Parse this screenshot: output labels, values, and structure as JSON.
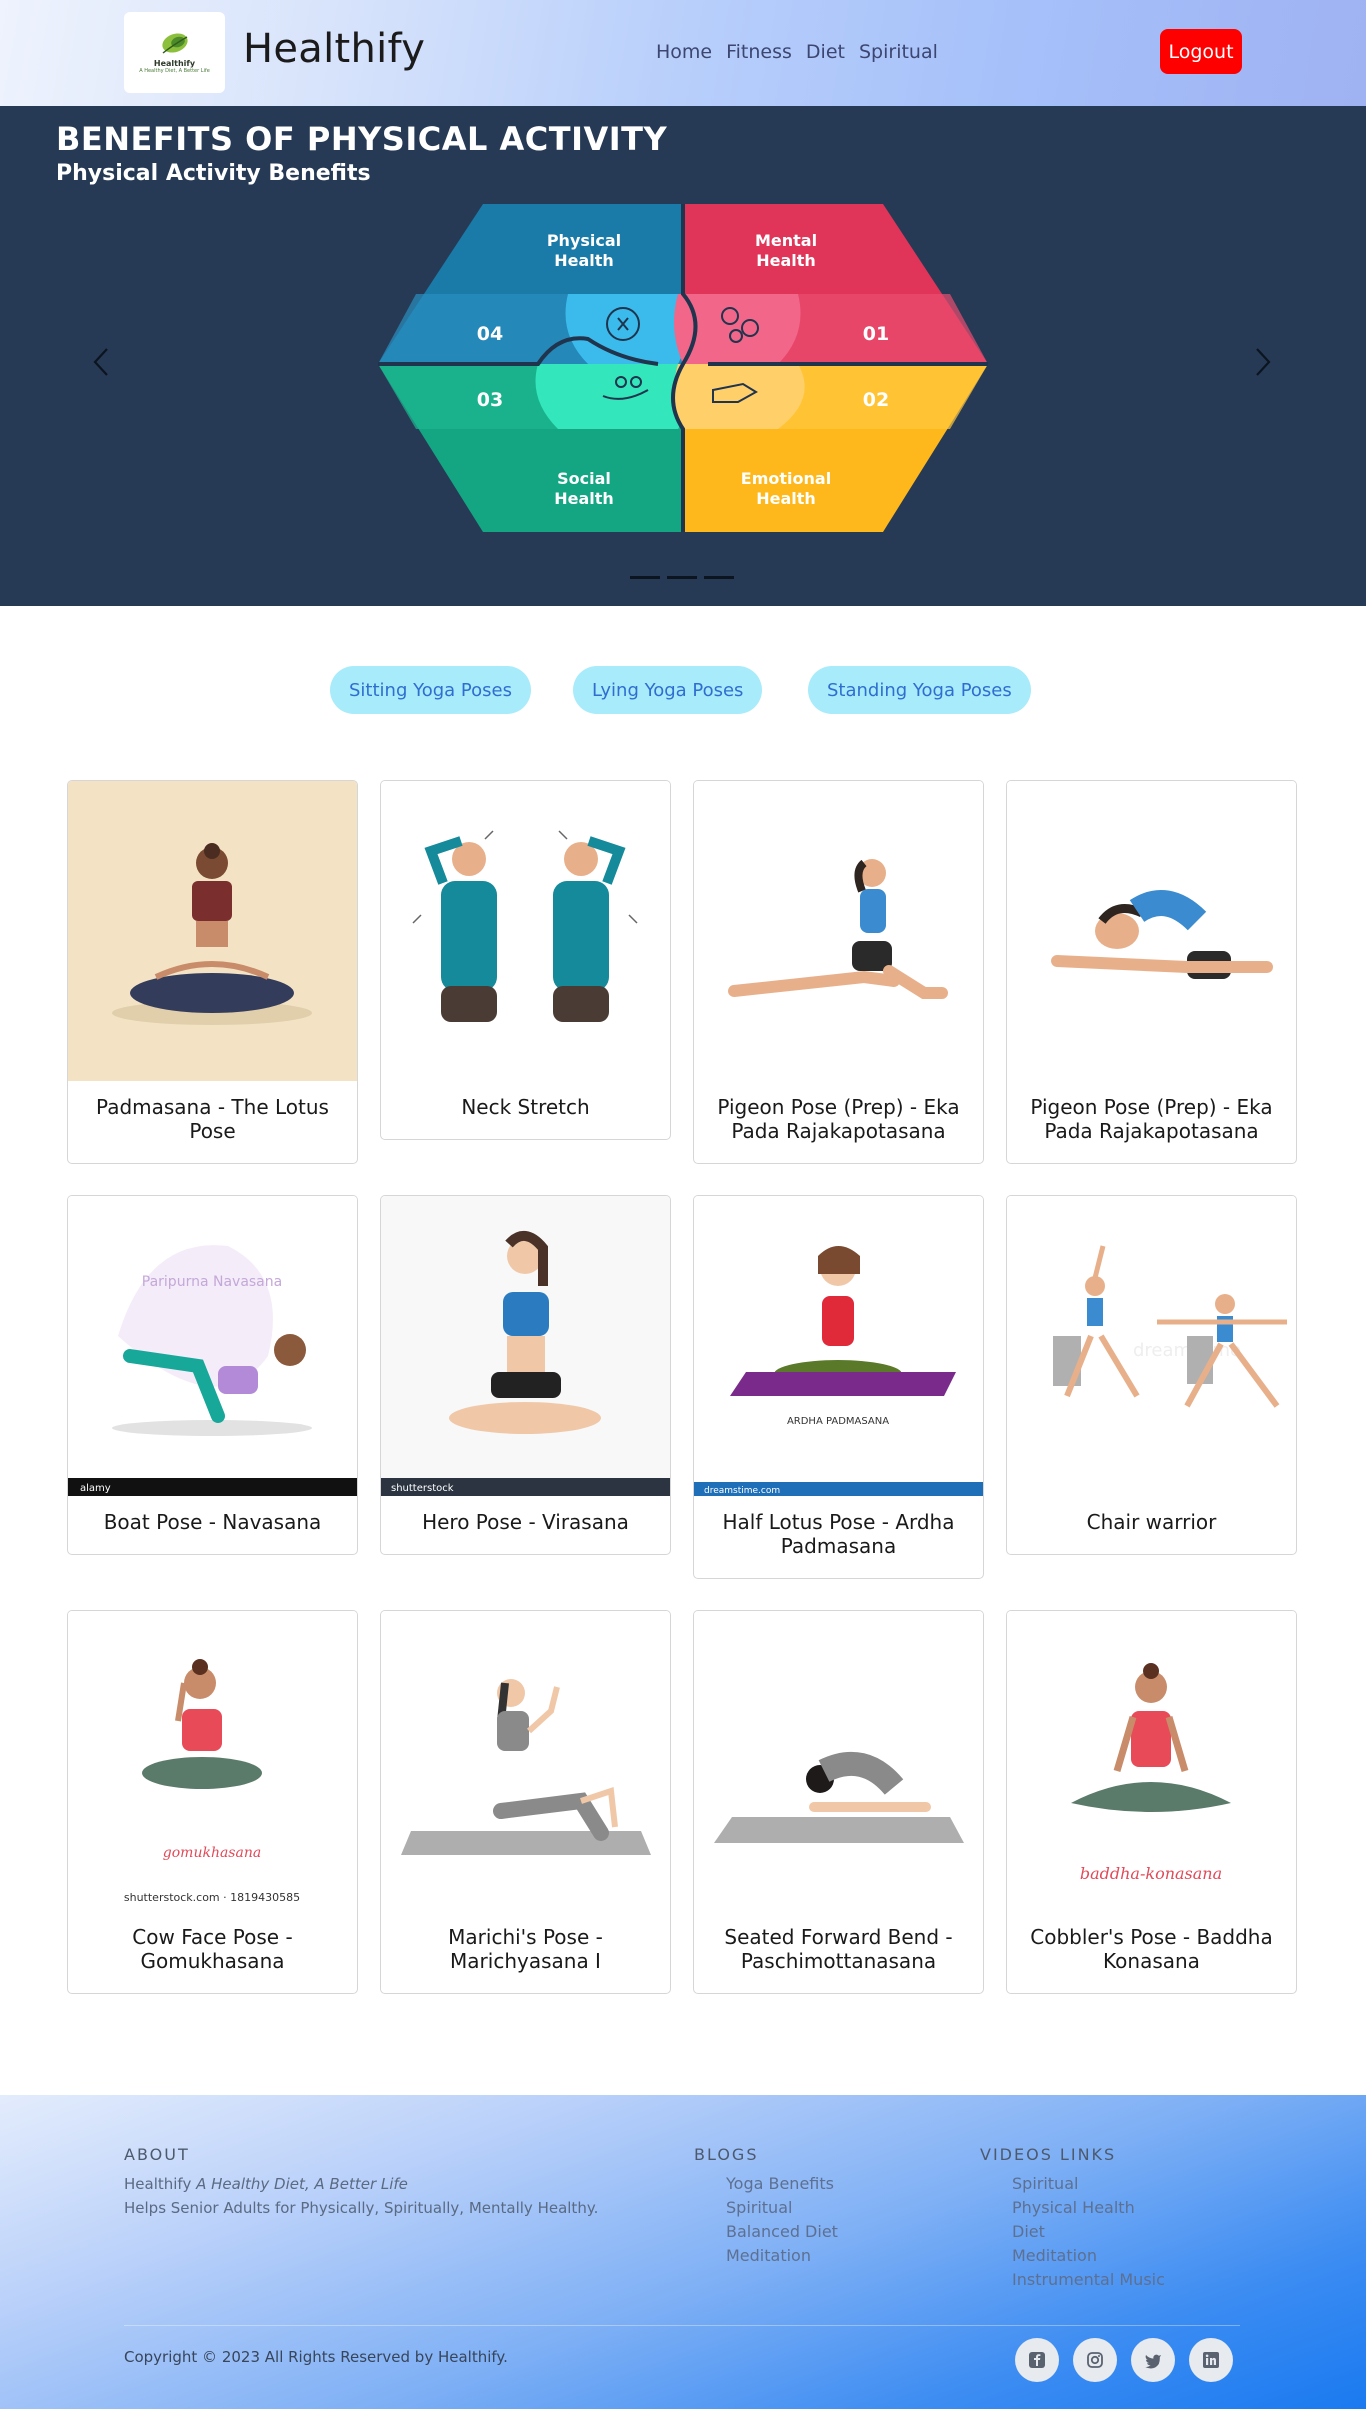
{
  "header": {
    "logo_title": "Healthify",
    "logo_tagline": "A Healthy Diet, A Better Life",
    "brand": "Healthify",
    "nav": [
      {
        "label": "Home"
      },
      {
        "label": "Fitness"
      },
      {
        "label": "Diet"
      },
      {
        "label": "Spiritual"
      }
    ],
    "logout_label": "Logout"
  },
  "carousel": {
    "title": "BENEFITS OF PHYSICAL ACTIVITY",
    "subtitle": "Physical Activity Benefits",
    "segments": [
      {
        "label": "Physical\nHealth",
        "number": "04",
        "color": "#1e88b8"
      },
      {
        "label": "Mental\nHealth",
        "number": "01",
        "color": "#e63b5c"
      },
      {
        "label": "Social\nHealth",
        "number": "03",
        "color": "#17b08a"
      },
      {
        "label": "Emotional\nHealth",
        "number": "02",
        "color": "#ffbf1f"
      }
    ],
    "indicators": 3,
    "active_indicator": 2
  },
  "filters": [
    {
      "label": "Sitting Yoga Poses"
    },
    {
      "label": "Lying Yoga Poses"
    },
    {
      "label": "Standing Yoga Poses"
    }
  ],
  "poses": [
    {
      "title": "Padmasana - The Lotus Pose"
    },
    {
      "title": "Neck Stretch"
    },
    {
      "title": "Pigeon Pose (Prep) - Eka Pada Rajakapotasana"
    },
    {
      "title": "Pigeon Pose (Prep) - Eka Pada Rajakapotasana"
    },
    {
      "title": "Boat Pose - Navasana",
      "image_caption": "Paripurna Navasana",
      "watermark": "alamy"
    },
    {
      "title": "Hero Pose - Virasana",
      "watermark": "shutterstock"
    },
    {
      "title": "Half Lotus Pose - Ardha Padmasana",
      "image_caption": "ARDHA PADMASANA",
      "watermark": "dreamstime.com"
    },
    {
      "title": "Chair warrior",
      "watermark": "dreamstime"
    },
    {
      "title": "Cow Face Pose - Gomukhasana",
      "image_caption": "gomukhasana",
      "watermark": "shutterstock.com · 1819430585"
    },
    {
      "title": "Marichi's Pose - Marichyasana I"
    },
    {
      "title": "Seated Forward Bend - Paschimottanasana"
    },
    {
      "title": "Cobbler's Pose - Baddha Konasana",
      "image_caption": "baddha-konasana"
    }
  ],
  "footer": {
    "about_heading": "ABOUT",
    "about_brand": "Healthify",
    "about_tagline": "A Healthy Diet, A Better Life",
    "about_desc": "Helps Senior Adults for Physically, Spiritually, Mentally Healthy.",
    "blogs_heading": "BLOGS",
    "blogs": [
      "Yoga Benefits",
      "Spiritual",
      "Balanced Diet",
      "Meditation"
    ],
    "videos_heading": "VIDEOS LINKS",
    "videos": [
      "Spiritual",
      "Physical Health",
      "Diet",
      "Meditation",
      "Instrumental Music"
    ],
    "copyright": "Copyright © 2023 All Rights Reserved by",
    "copyright_brand": "Healthify.",
    "social": [
      {
        "icon": "facebook-icon"
      },
      {
        "icon": "instagram-icon"
      },
      {
        "icon": "twitter-icon"
      },
      {
        "icon": "linkedin-icon"
      }
    ]
  }
}
